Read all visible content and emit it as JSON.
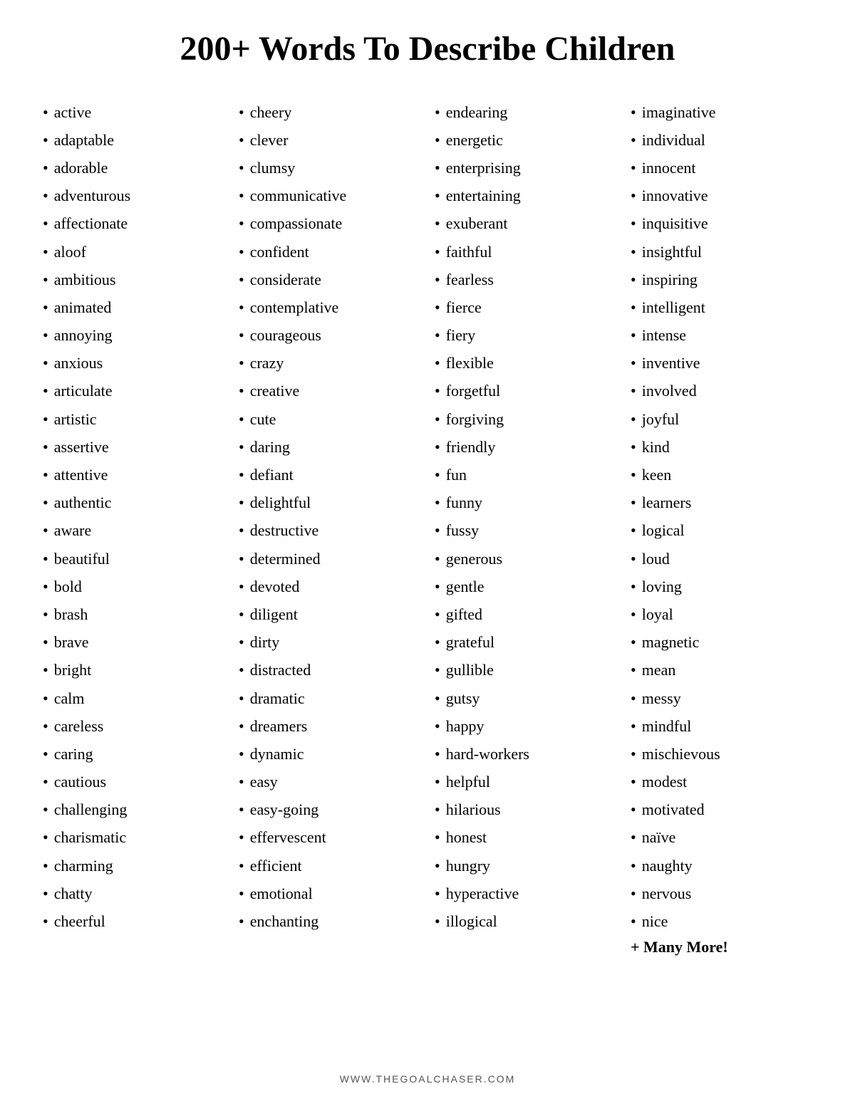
{
  "title": "200+ Words To Describe Children",
  "columns": [
    {
      "id": "col1",
      "items": [
        "active",
        "adaptable",
        "adorable",
        "adventurous",
        "affectionate",
        "aloof",
        "ambitious",
        "animated",
        "annoying",
        "anxious",
        "articulate",
        "artistic",
        "assertive",
        "attentive",
        "authentic",
        "aware",
        "beautiful",
        "bold",
        "brash",
        "brave",
        "bright",
        "calm",
        "careless",
        "caring",
        "cautious",
        "challenging",
        "charismatic",
        "charming",
        "chatty",
        "cheerful"
      ]
    },
    {
      "id": "col2",
      "items": [
        "cheery",
        "clever",
        "clumsy",
        "communicative",
        "compassionate",
        "confident",
        "considerate",
        "contemplative",
        "courageous",
        "crazy",
        "creative",
        "cute",
        "daring",
        "defiant",
        "delightful",
        "destructive",
        "determined",
        "devoted",
        "diligent",
        "dirty",
        "distracted",
        "dramatic",
        "dreamers",
        "dynamic",
        "easy",
        "easy-going",
        "effervescent",
        "efficient",
        "emotional",
        "enchanting"
      ]
    },
    {
      "id": "col3",
      "items": [
        "endearing",
        "energetic",
        "enterprising",
        "entertaining",
        "exuberant",
        "faithful",
        "fearless",
        "fierce",
        "fiery",
        "flexible",
        "forgetful",
        "forgiving",
        "friendly",
        "fun",
        "funny",
        "fussy",
        "generous",
        "gentle",
        "gifted",
        "grateful",
        "gullible",
        "gutsy",
        "happy",
        "hard-workers",
        "helpful",
        "hilarious",
        "honest",
        "hungry",
        "hyperactive",
        "illogical"
      ]
    },
    {
      "id": "col4",
      "items": [
        "imaginative",
        "individual",
        "innocent",
        "innovative",
        "inquisitive",
        "insightful",
        "inspiring",
        "intelligent",
        "intense",
        "inventive",
        "involved",
        "joyful",
        "kind",
        "keen",
        "learners",
        "logical",
        "loud",
        "loving",
        "loyal",
        "magnetic",
        "mean",
        "messy",
        "mindful",
        "mischievous",
        "modest",
        "motivated",
        "naïve",
        "naughty",
        "nervous",
        "nice"
      ]
    }
  ],
  "more_text": "+ Many More!",
  "footer": "WWW.THEGOALCHASER.COM"
}
